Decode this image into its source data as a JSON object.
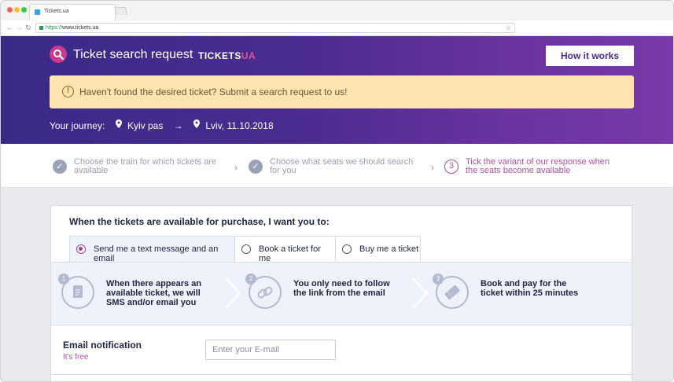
{
  "browser": {
    "tab_title": "Tickets.ua",
    "url_scheme": "https://",
    "url_host": "www.tickets.ua"
  },
  "header": {
    "title": "Ticket search request",
    "brand_main": "TICKETS",
    "brand_suffix": "UA",
    "how_it_works": "How it works"
  },
  "notice": {
    "icon": "!",
    "text": "Haven't found the desired ticket? Submit a search request to us!"
  },
  "journey": {
    "label": "Your journey:",
    "from": "Kyiv pas",
    "arrow": "→",
    "to": "Lviv, 11.10.2018"
  },
  "steps": [
    {
      "label": "Choose the train for which tickets are available",
      "state": "done",
      "mark": "✓"
    },
    {
      "label": "Choose what seats we should search for you",
      "state": "done",
      "mark": "✓"
    },
    {
      "label": "Tick the variant of our response when the seats become available",
      "state": "active",
      "mark": "3"
    }
  ],
  "form": {
    "title": "When the tickets are available for purchase, I want you to:",
    "options": [
      {
        "label": "Send me a text message and an email",
        "selected": true
      },
      {
        "label": "Book a ticket for me",
        "selected": false
      },
      {
        "label": "Buy me a ticket",
        "selected": false
      }
    ],
    "info": [
      {
        "num": "1",
        "icon": "document-icon",
        "text": "When there appears an available ticket, we will SMS and/or email you"
      },
      {
        "num": "2",
        "icon": "link-icon",
        "text": "You only need to follow the link from the email"
      },
      {
        "num": "3",
        "icon": "ticket-icon",
        "text": "Book and pay for the ticket within 25 minutes"
      }
    ],
    "email": {
      "label": "Email notification",
      "sub": "It's free",
      "placeholder": "Enter your E-mail"
    }
  },
  "colors": {
    "header_start": "#3a2a86",
    "header_end": "#7a3aa8",
    "accent": "#b34f9f",
    "notice_bg": "#fbe4b0"
  }
}
